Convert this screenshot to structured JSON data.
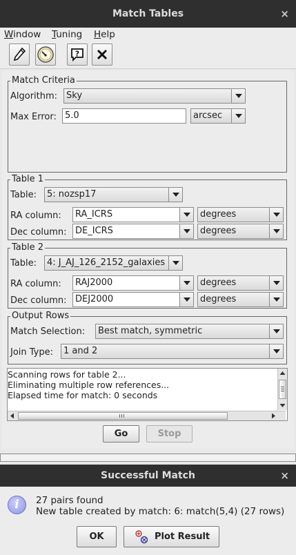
{
  "window": {
    "title": "Match Tables",
    "close_glyph": "×"
  },
  "menu": {
    "window": {
      "mnemonic": "W",
      "rest": "indow"
    },
    "tuning": {
      "mnemonic": "T",
      "rest": "uning"
    },
    "help": {
      "mnemonic": "H",
      "rest": "elp"
    }
  },
  "toolbar": {
    "icons": [
      "pencil-icon",
      "gauge-icon",
      "help-icon",
      "close-icon"
    ]
  },
  "match_criteria": {
    "legend": "Match Criteria",
    "algorithm_label": "Algorithm:",
    "algorithm_value": "Sky",
    "max_error_label": "Max Error:",
    "max_error_value": "5.0",
    "max_error_unit": "arcsec"
  },
  "table1": {
    "legend": "Table 1",
    "table_label": "Table:",
    "table_value": "5: nozsp17",
    "ra_label": "RA column:",
    "ra_value": "RA_ICRS",
    "ra_unit": "degrees",
    "dec_label": "Dec column:",
    "dec_value": "DE_ICRS",
    "dec_unit": "degrees"
  },
  "table2": {
    "legend": "Table 2",
    "table_label": "Table:",
    "table_value": "4: J_AJ_126_2152_galaxies",
    "ra_label": "RA column:",
    "ra_value": "RAJ2000",
    "ra_unit": "degrees",
    "dec_label": "Dec column:",
    "dec_value": "DEJ2000",
    "dec_unit": "degrees"
  },
  "output_rows": {
    "legend": "Output Rows",
    "selection_label": "Match Selection:",
    "selection_value": "Best match, symmetric",
    "join_label": "Join Type:",
    "join_value": "1 and 2"
  },
  "log": {
    "lines": [
      "Scanning rows for table 2...",
      "Eliminating multiple row references...",
      "Elapsed time for match: 0 seconds"
    ]
  },
  "actions": {
    "go": "Go",
    "stop": "Stop"
  },
  "dialog": {
    "title": "Successful Match",
    "close_glyph": "×",
    "line1": "27 pairs found",
    "line2": "New table created by match: 6: match(5,4) (27 rows)",
    "ok": "OK",
    "plot": "Plot Result"
  }
}
